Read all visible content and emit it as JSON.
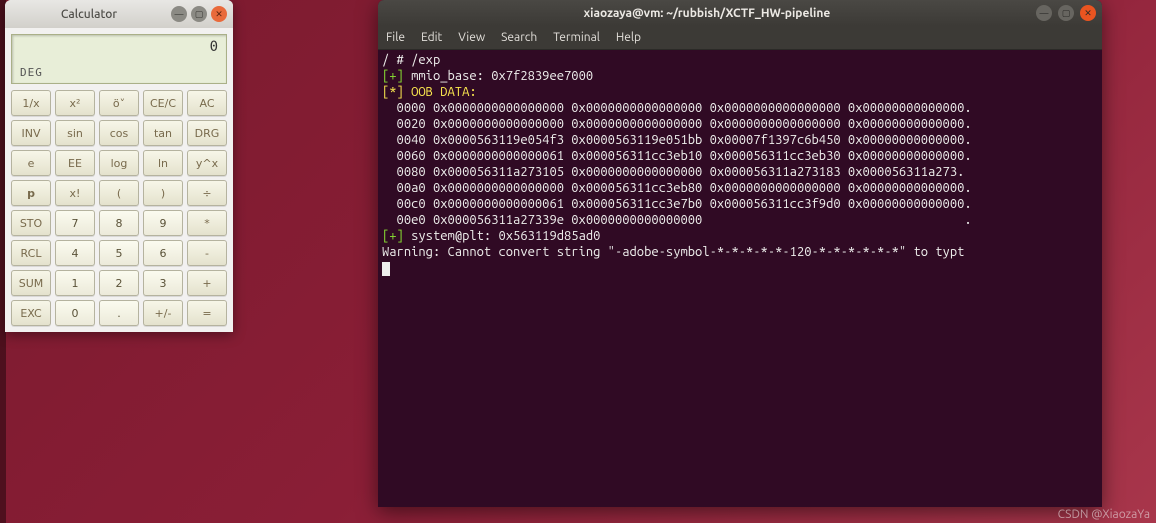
{
  "calculator": {
    "title": "Calculator",
    "display_value": "0",
    "display_mode": "DEG",
    "rows": [
      [
        "1/x",
        "x²",
        "ö˅",
        "CE/C",
        "AC"
      ],
      [
        "INV",
        "sin",
        "cos",
        "tan",
        "DRG"
      ],
      [
        "e",
        "EE",
        "log",
        "ln",
        "y^x"
      ],
      [
        "p",
        "x!",
        "(",
        ")",
        "÷"
      ],
      [
        "STO",
        "7",
        "8",
        "9",
        "*"
      ],
      [
        "RCL",
        "4",
        "5",
        "6",
        "-"
      ],
      [
        "SUM",
        "1",
        "2",
        "3",
        "+"
      ],
      [
        "EXC",
        "0",
        ".",
        "+/-",
        "="
      ]
    ]
  },
  "terminal": {
    "title": "xiaozaya@vm: ~/rubbish/XCTF_HW-pipeline",
    "menu": [
      "File",
      "Edit",
      "View",
      "Search",
      "Terminal",
      "Help"
    ],
    "lines": [
      {
        "segs": [
          {
            "c": "w",
            "t": "/ # /exp"
          }
        ]
      },
      {
        "segs": [
          {
            "c": "g",
            "t": "[+]"
          },
          {
            "c": "w",
            "t": " mmio_base: 0x7f2839ee7000"
          }
        ]
      },
      {
        "segs": [
          {
            "c": "y",
            "t": "[*] OOB DATA:"
          }
        ]
      },
      {
        "segs": [
          {
            "c": "w",
            "t": "  0000 0x0000000000000000 0x0000000000000000 0x0000000000000000 0x00000000000000."
          }
        ]
      },
      {
        "segs": [
          {
            "c": "w",
            "t": "  0020 0x0000000000000000 0x0000000000000000 0x0000000000000000 0x00000000000000."
          }
        ]
      },
      {
        "segs": [
          {
            "c": "w",
            "t": "  0040 0x0000563119e054f3 0x0000563119e051bb 0x00007f1397c6b450 0x00000000000000."
          }
        ]
      },
      {
        "segs": [
          {
            "c": "w",
            "t": "  0060 0x0000000000000061 0x000056311cc3eb10 0x000056311cc3eb30 0x00000000000000."
          }
        ]
      },
      {
        "segs": [
          {
            "c": "w",
            "t": "  0080 0x000056311a273105 0x0000000000000000 0x000056311a273183 0x000056311a273."
          }
        ]
      },
      {
        "segs": [
          {
            "c": "w",
            "t": "  00a0 0x0000000000000000 0x000056311cc3eb80 0x0000000000000000 0x00000000000000."
          }
        ]
      },
      {
        "segs": [
          {
            "c": "w",
            "t": "  00c0 0x0000000000000061 0x000056311cc3e7b0 0x000056311cc3f9d0 0x00000000000000."
          }
        ]
      },
      {
        "segs": [
          {
            "c": "w",
            "t": "  00e0 0x000056311a27339e 0x0000000000000000                                    ."
          }
        ]
      },
      {
        "segs": [
          {
            "c": "g",
            "t": "[+]"
          },
          {
            "c": "w",
            "t": " system@plt: 0x563119d85ad0"
          }
        ]
      },
      {
        "segs": [
          {
            "c": "w",
            "t": "Warning: Cannot convert string \"-adobe-symbol-*-*-*-*-*-120-*-*-*-*-*-*\" to typt"
          }
        ]
      }
    ]
  },
  "watermark": "CSDN @XiaozaYa"
}
